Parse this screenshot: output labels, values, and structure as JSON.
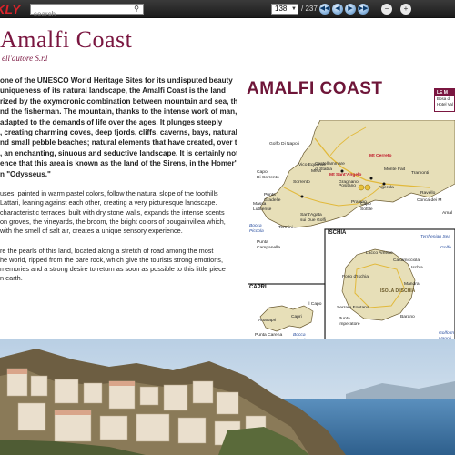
{
  "toolbar": {
    "brand": "EKLY",
    "search_placeholder": "search",
    "search_icon": "search-icon",
    "page_current": "138",
    "page_total": "/ 237",
    "nav_icons": [
      "first-page-icon",
      "previous-page-icon",
      "next-page-icon",
      "last-page-icon"
    ],
    "zoom_icons": [
      "zoom-out-icon",
      "zoom-in-icon"
    ]
  },
  "article": {
    "title": "Amalfi Coast",
    "subtitle": "ell'autore S.r.l",
    "para1": [
      "one of the UNESCO World Heritage Sites for its undisputed beauty",
      "uniqueness of its natural landscape, the Amalfi Coast is the land",
      "rized by the oxymoronic combination between mountain and sea, the",
      "nd the fisherman. The mountain, thanks to the intense work of man,",
      "adapted to the demands of life over the ages. It plunges steeply",
      ", creating charming coves, deep fjords, cliffs, caverns, bays, natural",
      "nd small pebble beaches; natural elements that have created, over the",
      ", an enchanting, sinuous and seductive landscape. It is certainly not",
      "ence that this area is known as the land of the Sirens, in the Homer's",
      "n \"Odysseus.\""
    ],
    "para2": [
      "uses, painted in warm pastel colors, follow the natural slope of the foothills",
      " Lattari, leaning against each other, creating a very picturesque landscape.",
      "characteristic terraces, built with dry stone walls, expands the intense scents",
      "on groves, the vineyards, the broom, the bright colors of bougainvillea which,",
      " with the smell of salt air, creates a unique sensory experience."
    ],
    "para3": [
      "re the pearls of this land, located along a stretch of road among the most",
      "he world, ripped from the bare rock, which give the tourists strong emotions,",
      "memories and a strong desire to return as soon as possible to this little piece",
      "n earth."
    ]
  },
  "map": {
    "title": "AMALFI COAST",
    "legend_head": "LE M",
    "legend_lines": [
      "Bosa di",
      "Hotel Val"
    ],
    "colors": {
      "land": "#e7dfb8",
      "sea": "#ffffff",
      "road": "#e2b93b",
      "border": "#7a1640",
      "coast": "#6a5a30"
    },
    "labels": {
      "golfo_napoli": "Golfo Di Napoli",
      "castellammare": "Castellammare\ndi Stabia",
      "gragnano": "Gragnano",
      "mt_cerreto": "Mt Cerreto",
      "punta_gradelle": "Punta\nGradelle",
      "vico_equense": "Vico Equense",
      "meta": "Meta",
      "tramonti": "Tramonti",
      "monte_faito": "Monte Fait",
      "capo_sorrento": "Capo\nDi Sorrento",
      "sorrento": "Sorrento",
      "mt_santangelo": "Mt Sant'Angelo",
      "positano": "Positano",
      "agerola": "Agerola",
      "ravello": "Ravello",
      "massa_lubrense": "Massa\nLubrense",
      "capo_sottile": "Capo\nSottile",
      "praiano": "Praiano",
      "conca_dei_marini": "Conca dei M",
      "santagata": "Sant'Agata\nsui Due Golfi",
      "amalfi": "Amal",
      "termini": "Termini",
      "bocca_piccola_1": "Bocca\nPiccola",
      "punta_campanella": "Punta\nCampanella",
      "ischia_title": "ISCHIA",
      "tyrrhenian": "Tyrrhenian Sea",
      "golfo_salerno": "Golfo",
      "lacco_ameno": "Lacco Ameno",
      "casamicciola": "Casamicciola",
      "ischia_town": "Ischia",
      "forio": "Forio d'Ischia",
      "isola_ischia": "ISOLA D'ISCHIA",
      "mandra": "Mandra",
      "capri_title": "CAPRI",
      "capri_town": "Capri",
      "il_capo": "Il Capo",
      "anacapri": "Anacapri",
      "punta_carena": "Punta Carena",
      "serrara": "Serrara Fontana",
      "punta_imperatore": "Punta\nImperatore",
      "barano": "Barano",
      "bocca_piccola_2": "Bocca\nPiccola",
      "golfo_napoli_2": "Golfo In\nNapoli"
    }
  },
  "photo": {
    "sky": "#cfe0ef",
    "sea": "#4f86b5",
    "cliff": "#7a6a4a",
    "houses": "#e8dccb"
  }
}
